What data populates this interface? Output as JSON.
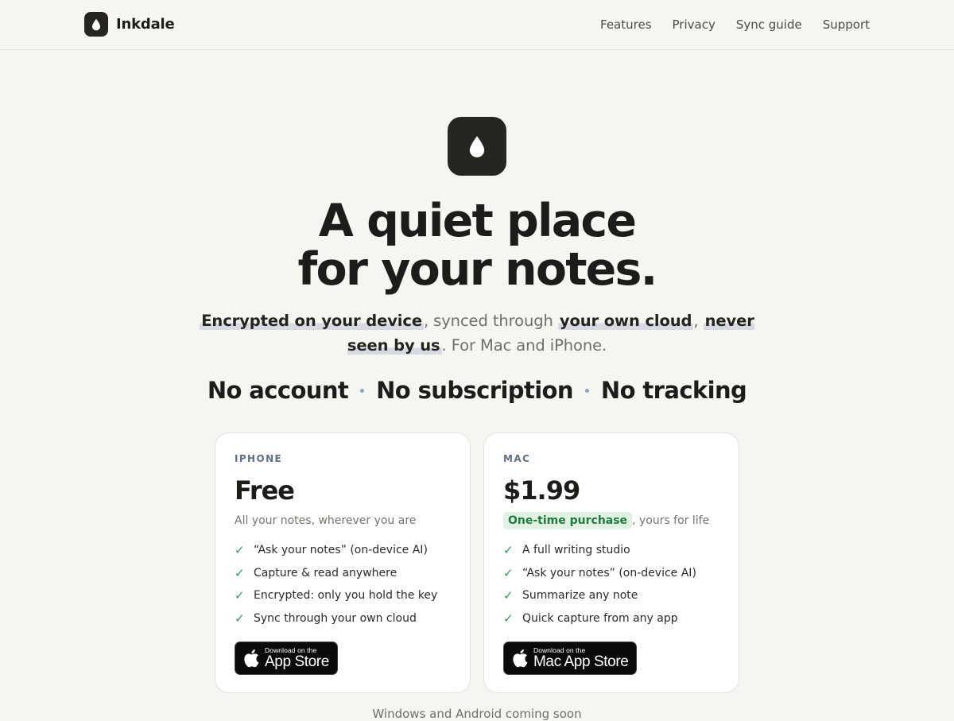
{
  "header": {
    "brand": "Inkdale",
    "nav": [
      "Features",
      "Privacy",
      "Sync guide",
      "Support"
    ]
  },
  "hero": {
    "headline_line1": "A quiet place",
    "headline_line2": "for your notes.",
    "subline": {
      "hl1": "Encrypted on your device",
      "t1": ", synced through ",
      "hl2": "your own cloud",
      "t2": ", ",
      "hl3": "never seen by us",
      "t3": ". For Mac and iPhone."
    },
    "pillars": [
      "No account",
      "No subscription",
      "No tracking"
    ]
  },
  "cards": {
    "iphone": {
      "eyebrow": "IPHONE",
      "price": "Free",
      "note": "All your notes, wherever you are",
      "features": [
        "“Ask your notes” (on-device AI)",
        "Capture & read anywhere",
        "Encrypted: only you hold the key",
        "Sync through your own cloud"
      ],
      "button_small": "Download on the",
      "button_big": "App Store"
    },
    "mac": {
      "eyebrow": "MAC",
      "price": "$1.99",
      "badge": "One-time purchase",
      "note_suffix": ", yours for life",
      "features": [
        "A full writing studio",
        "“Ask your notes” (on-device AI)",
        "Summarize any note",
        "Quick capture from any app"
      ],
      "button_small": "Download on the",
      "button_big": "Mac App Store"
    }
  },
  "check_glyph": "✓",
  "footer_note": "Windows and Android coming soon",
  "colors": {
    "background": "#f6f6f1",
    "logo_bg": "#26251f",
    "check": "#2f9a55",
    "badge_bg": "#e1f1e4",
    "badge_text": "#1f7a3c",
    "eyebrow": "#5f6f88",
    "dot": "#8ba1c9"
  },
  "icons": {
    "logo": "ink-drop-icon",
    "store": "apple-logo-icon"
  }
}
